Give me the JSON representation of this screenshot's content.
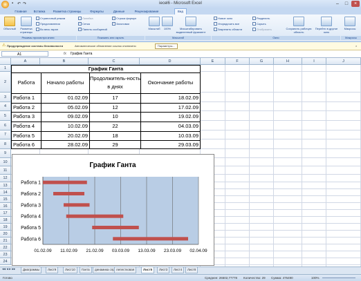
{
  "window": {
    "title": "iecel6 - Microsoft Excel",
    "tabs": [
      "Главная",
      "Вставка",
      "Разметка страницы",
      "Формулы",
      "Данные",
      "Рецензирование",
      "Вид"
    ],
    "active_tab": "Вид"
  },
  "ribbon": {
    "view_modes": [
      "Обычный",
      "Разметка страницы"
    ],
    "view_small": [
      "Страничный режим",
      "Представления",
      "Во весь экран"
    ],
    "show_hide": [
      "Линейка",
      "Сетка",
      "Панель сообщений",
      "Строка формул",
      "Заголовки"
    ],
    "zoom": [
      "Масштаб",
      "100%",
      "Масштабировать выделенный фрагмент"
    ],
    "window_items": [
      "Новое окно",
      "Упорядочить все",
      "Закрепить области",
      "Разделить",
      "Скрыть",
      "Отобразить",
      "Сохранить рабочую область",
      "Перейти в другое окно"
    ],
    "macros": "Макросы",
    "group_labels": [
      "Режимы просмотра книги",
      "Показать или скрыть",
      "Масштаб",
      "Окно",
      "Макросы"
    ]
  },
  "security_bar": {
    "title": "Предупреждение системы безопасности",
    "message": "Автоматическое обновление ссылок отключено",
    "button": "Параметры..."
  },
  "formula_bar": {
    "name_box": "A1",
    "fx": "fx",
    "content": "График Ганта"
  },
  "sheet": {
    "columns": [
      "A",
      "B",
      "C",
      "D",
      "E",
      "F",
      "G",
      "H",
      "I",
      "J"
    ],
    "rows": [
      "1",
      "2",
      "3",
      "4",
      "5",
      "6",
      "7",
      "8",
      "9",
      "10",
      "11",
      "12",
      "13",
      "14",
      "15",
      "16",
      "17",
      "18",
      "19",
      "20",
      "21",
      "22",
      "23",
      "24"
    ],
    "table_title": "График Ганта",
    "headers": [
      "Работа",
      "Начало работы",
      "Продолжитель-ность в днях",
      "Окончание работы"
    ],
    "data": [
      [
        "Работа 1",
        "01.02.09",
        "17",
        "18.02.09"
      ],
      [
        "Работа 2",
        "05.02.09",
        "12",
        "17.02.09"
      ],
      [
        "Работа 3",
        "09.02.09",
        "10",
        "19.02.09"
      ],
      [
        "Работа 4",
        "10.02.09",
        "22",
        "04.03.09"
      ],
      [
        "Работа 5",
        "20.02.09",
        "18",
        "10.03.09"
      ],
      [
        "Работа 6",
        "28.02.09",
        "29",
        "29.03.09"
      ]
    ]
  },
  "chart_data": {
    "type": "bar",
    "orientation": "horizontal",
    "title": "График Ганта",
    "categories": [
      "Работа 1",
      "Работа 2",
      "Работа 3",
      "Работа 4",
      "Работа 5",
      "Работа 6"
    ],
    "series": [
      {
        "start": [
          "01.02.09",
          "05.02.09",
          "09.02.09",
          "10.02.09",
          "20.02.09",
          "28.02.09"
        ],
        "end": [
          "18.02.09",
          "17.02.09",
          "19.02.09",
          "04.03.09",
          "10.03.09",
          "29.03.09"
        ]
      }
    ],
    "xticks": [
      "01.02.09",
      "11.02.09",
      "21.02.09",
      "03.03.09",
      "13.03.09",
      "23.03.09",
      "02.04.09"
    ],
    "bar_color": "#c0504d",
    "plot_bg": "#b9cde5",
    "grid": true,
    "legend": "none"
  },
  "sheet_tabs": [
    "Диаграммы",
    "Лист9",
    "Лист10",
    "Ганта",
    "динамика спроса",
    "лепестковая",
    "Лист5",
    "Лист3",
    "Лист4",
    "Лист8"
  ],
  "active_sheet": "Лист5",
  "status": {
    "ready": "Готово",
    "average": "Среднее: 26502,77778",
    "count": "Количество: 29",
    "sum": "Сумма: 476490",
    "zoom": "100%"
  }
}
